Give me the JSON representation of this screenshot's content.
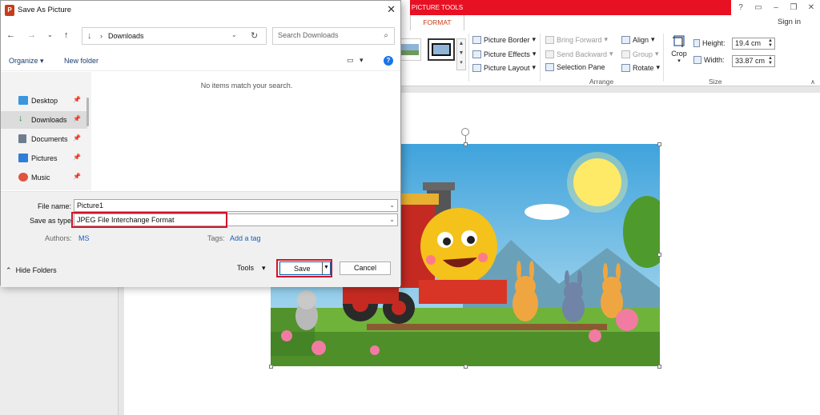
{
  "powerpoint": {
    "picture_tools_label": "PICTURE TOOLS",
    "format_tab_label": "FORMAT",
    "sign_in": "Sign in",
    "window_controls": [
      "?",
      "▭",
      "–",
      "❐",
      "✕"
    ],
    "ribbon": {
      "picture_styles": {
        "border": "Picture Border",
        "effects": "Picture Effects",
        "layout": "Picture Layout"
      },
      "arrange": {
        "bring_forward": "Bring Forward",
        "send_backward": "Send Backward",
        "selection_pane": "Selection Pane",
        "align": "Align",
        "group": "Group",
        "rotate": "Rotate",
        "group_label": "Arrange"
      },
      "size": {
        "crop": "Crop",
        "height_label": "Height:",
        "height_value": "19.4 cm",
        "width_label": "Width:",
        "width_value": "33.87 cm",
        "group_label": "Size"
      }
    }
  },
  "dialog": {
    "title": "Save As Picture",
    "app_icon": "P",
    "address_path": "Downloads",
    "search_placeholder": "Search Downloads",
    "organize": "Organize",
    "new_folder": "New folder",
    "help": "?",
    "empty_message": "No items match your search.",
    "nav_items": [
      {
        "label": "Desktop",
        "color": "#3a96dd"
      },
      {
        "label": "Downloads",
        "color": "#1e8a3c"
      },
      {
        "label": "Documents",
        "color": "#6d7d8f"
      },
      {
        "label": "Pictures",
        "color": "#2f7fd6"
      },
      {
        "label": "Music",
        "color": "#e0533d"
      }
    ],
    "file_name_label": "File name:",
    "file_name_value": "Picture1",
    "save_type_label": "Save as type:",
    "save_type_value": "JPEG File Interchange Format",
    "authors_label": "Authors:",
    "authors_value": "MS",
    "tags_label": "Tags:",
    "tags_value": "Add a tag",
    "hide_folders": "Hide Folders",
    "tools": "Tools",
    "save": "Save",
    "cancel": "Cancel"
  },
  "colors": {
    "accent_red": "#e81123",
    "highlight_red": "#d0142c",
    "link_blue": "#1a5fb4"
  }
}
